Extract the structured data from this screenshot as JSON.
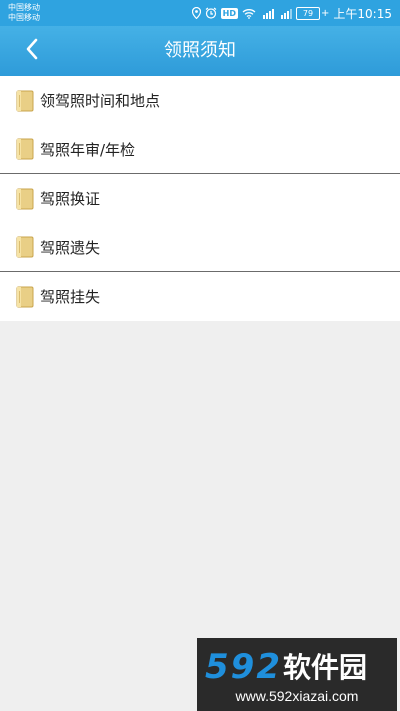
{
  "status_bar": {
    "carrier_1": "中国移动",
    "carrier_2": "中国移动",
    "hd_badge": "HD",
    "battery_level": "79",
    "time": "上午10:15",
    "icons": [
      "location-icon",
      "alarm-icon",
      "hd-icon",
      "wifi-icon",
      "signal-4g-icon",
      "signal-2g-icon",
      "battery-icon"
    ]
  },
  "header": {
    "title": "领照须知",
    "back_icon": "chevron-left-icon"
  },
  "list": {
    "items": [
      {
        "label": "领驾照时间和地点",
        "icon": "folder-icon"
      },
      {
        "label": "驾照年审/年检",
        "icon": "folder-icon"
      },
      {
        "label": "驾照换证",
        "icon": "folder-icon"
      },
      {
        "label": "驾照遗失",
        "icon": "folder-icon"
      },
      {
        "label": "驾照挂失",
        "icon": "folder-icon"
      }
    ]
  },
  "watermark": {
    "logo_text": "592软件园",
    "url": "www.592xiazai.com"
  },
  "colors": {
    "accent": "#2fa3e0",
    "background": "#efefef",
    "watermark_bg": "#2a2a2a",
    "watermark_blue": "#1f8fdc"
  }
}
